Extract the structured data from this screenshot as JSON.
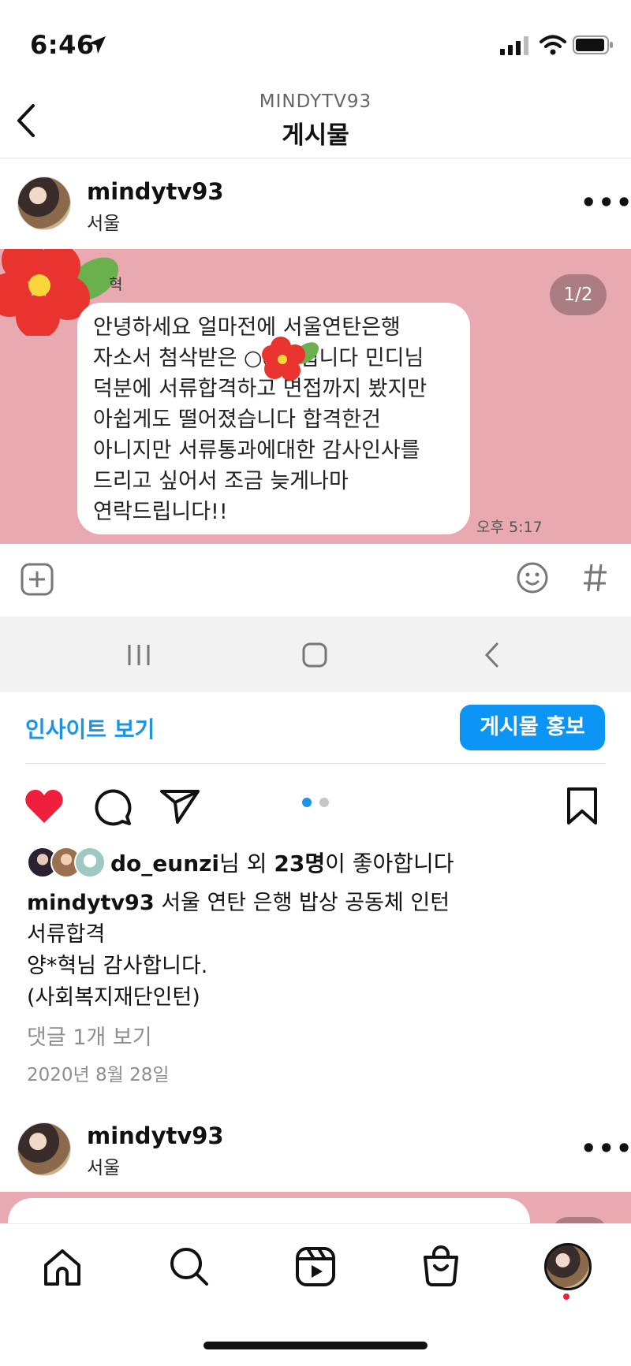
{
  "status_bar": {
    "time": "6:46"
  },
  "header": {
    "account": "MINDYTV93",
    "title": "게시물"
  },
  "post": {
    "username": "mindytv93",
    "location": "서울",
    "image": {
      "page_indicator": "1/2",
      "chat_name_fragment": "혁",
      "chat_message": "안녕하세요 얼마전에 서울연탄은행\n자소서 첨삭받은 ○○○입니다 민디님\n덕분에 서류합격하고 면접까지 봤지만\n아쉽게도 떨어졌습니다 합격한건\n아니지만 서류통과에대한 감사인사를\n드리고 싶어서 조금 늦게나마\n연락드립니다!!",
      "chat_time": "오후 5:17"
    },
    "insights_label": "인사이트 보기",
    "promote_label": "게시물 홍보",
    "carousel": {
      "count": 2,
      "active": 1
    },
    "likes": {
      "first_user": "do_eunzi",
      "suffix_1": "님 외 ",
      "count_text": "23명",
      "suffix_2": "이 좋아합니다"
    },
    "caption": {
      "username": "mindytv93",
      "text": " 서울 연탄 은행 밥상 공동체 인턴\n서류합격\n양*혁님 감사합니다.\n(사회복지재단인턴)"
    },
    "comments_link": "댓글 1개 보기",
    "date": "2020년 8월 28일"
  },
  "next_post": {
    "username": "mindytv93",
    "location": "서울"
  },
  "colors": {
    "accent": "#0d95f6",
    "like": "#ed1f3c",
    "post_bg": "#e8a9b0"
  },
  "icons": [
    "back-icon",
    "more-icon",
    "add-icon",
    "emoji-icon",
    "hashtag-icon",
    "recent-apps-icon",
    "android-home-icon",
    "android-back-icon",
    "heart-icon",
    "comment-icon",
    "share-icon",
    "bookmark-icon",
    "home-icon",
    "search-icon",
    "reels-icon",
    "shop-icon",
    "profile-icon"
  ]
}
